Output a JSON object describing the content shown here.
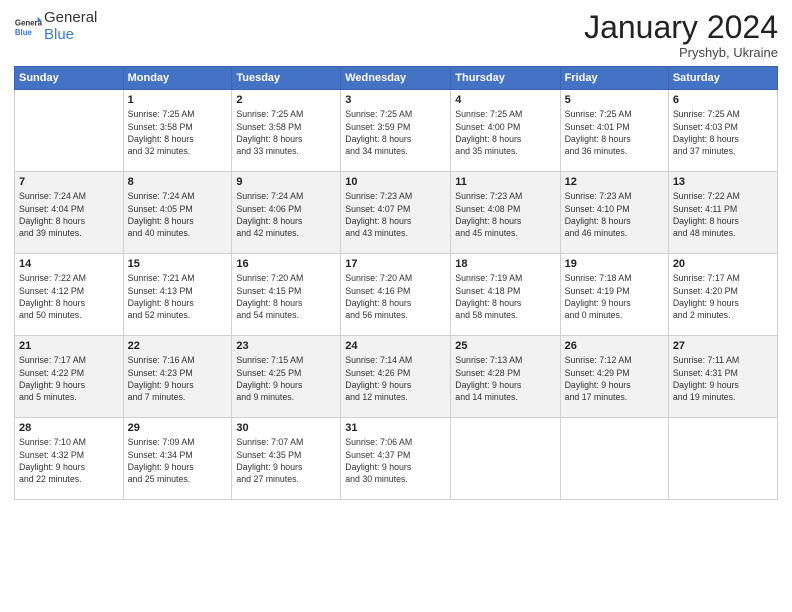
{
  "header": {
    "logo_general": "General",
    "logo_blue": "Blue",
    "month_title": "January 2024",
    "subtitle": "Pryshyb, Ukraine"
  },
  "days_of_week": [
    "Sunday",
    "Monday",
    "Tuesday",
    "Wednesday",
    "Thursday",
    "Friday",
    "Saturday"
  ],
  "weeks": [
    [
      {
        "day": "",
        "detail": ""
      },
      {
        "day": "1",
        "detail": "Sunrise: 7:25 AM\nSunset: 3:58 PM\nDaylight: 8 hours\nand 32 minutes."
      },
      {
        "day": "2",
        "detail": "Sunrise: 7:25 AM\nSunset: 3:58 PM\nDaylight: 8 hours\nand 33 minutes."
      },
      {
        "day": "3",
        "detail": "Sunrise: 7:25 AM\nSunset: 3:59 PM\nDaylight: 8 hours\nand 34 minutes."
      },
      {
        "day": "4",
        "detail": "Sunrise: 7:25 AM\nSunset: 4:00 PM\nDaylight: 8 hours\nand 35 minutes."
      },
      {
        "day": "5",
        "detail": "Sunrise: 7:25 AM\nSunset: 4:01 PM\nDaylight: 8 hours\nand 36 minutes."
      },
      {
        "day": "6",
        "detail": "Sunrise: 7:25 AM\nSunset: 4:03 PM\nDaylight: 8 hours\nand 37 minutes."
      }
    ],
    [
      {
        "day": "7",
        "detail": "Sunrise: 7:24 AM\nSunset: 4:04 PM\nDaylight: 8 hours\nand 39 minutes."
      },
      {
        "day": "8",
        "detail": "Sunrise: 7:24 AM\nSunset: 4:05 PM\nDaylight: 8 hours\nand 40 minutes."
      },
      {
        "day": "9",
        "detail": "Sunrise: 7:24 AM\nSunset: 4:06 PM\nDaylight: 8 hours\nand 42 minutes."
      },
      {
        "day": "10",
        "detail": "Sunrise: 7:23 AM\nSunset: 4:07 PM\nDaylight: 8 hours\nand 43 minutes."
      },
      {
        "day": "11",
        "detail": "Sunrise: 7:23 AM\nSunset: 4:08 PM\nDaylight: 8 hours\nand 45 minutes."
      },
      {
        "day": "12",
        "detail": "Sunrise: 7:23 AM\nSunset: 4:10 PM\nDaylight: 8 hours\nand 46 minutes."
      },
      {
        "day": "13",
        "detail": "Sunrise: 7:22 AM\nSunset: 4:11 PM\nDaylight: 8 hours\nand 48 minutes."
      }
    ],
    [
      {
        "day": "14",
        "detail": "Sunrise: 7:22 AM\nSunset: 4:12 PM\nDaylight: 8 hours\nand 50 minutes."
      },
      {
        "day": "15",
        "detail": "Sunrise: 7:21 AM\nSunset: 4:13 PM\nDaylight: 8 hours\nand 52 minutes."
      },
      {
        "day": "16",
        "detail": "Sunrise: 7:20 AM\nSunset: 4:15 PM\nDaylight: 8 hours\nand 54 minutes."
      },
      {
        "day": "17",
        "detail": "Sunrise: 7:20 AM\nSunset: 4:16 PM\nDaylight: 8 hours\nand 56 minutes."
      },
      {
        "day": "18",
        "detail": "Sunrise: 7:19 AM\nSunset: 4:18 PM\nDaylight: 8 hours\nand 58 minutes."
      },
      {
        "day": "19",
        "detail": "Sunrise: 7:18 AM\nSunset: 4:19 PM\nDaylight: 9 hours\nand 0 minutes."
      },
      {
        "day": "20",
        "detail": "Sunrise: 7:17 AM\nSunset: 4:20 PM\nDaylight: 9 hours\nand 2 minutes."
      }
    ],
    [
      {
        "day": "21",
        "detail": "Sunrise: 7:17 AM\nSunset: 4:22 PM\nDaylight: 9 hours\nand 5 minutes."
      },
      {
        "day": "22",
        "detail": "Sunrise: 7:16 AM\nSunset: 4:23 PM\nDaylight: 9 hours\nand 7 minutes."
      },
      {
        "day": "23",
        "detail": "Sunrise: 7:15 AM\nSunset: 4:25 PM\nDaylight: 9 hours\nand 9 minutes."
      },
      {
        "day": "24",
        "detail": "Sunrise: 7:14 AM\nSunset: 4:26 PM\nDaylight: 9 hours\nand 12 minutes."
      },
      {
        "day": "25",
        "detail": "Sunrise: 7:13 AM\nSunset: 4:28 PM\nDaylight: 9 hours\nand 14 minutes."
      },
      {
        "day": "26",
        "detail": "Sunrise: 7:12 AM\nSunset: 4:29 PM\nDaylight: 9 hours\nand 17 minutes."
      },
      {
        "day": "27",
        "detail": "Sunrise: 7:11 AM\nSunset: 4:31 PM\nDaylight: 9 hours\nand 19 minutes."
      }
    ],
    [
      {
        "day": "28",
        "detail": "Sunrise: 7:10 AM\nSunset: 4:32 PM\nDaylight: 9 hours\nand 22 minutes."
      },
      {
        "day": "29",
        "detail": "Sunrise: 7:09 AM\nSunset: 4:34 PM\nDaylight: 9 hours\nand 25 minutes."
      },
      {
        "day": "30",
        "detail": "Sunrise: 7:07 AM\nSunset: 4:35 PM\nDaylight: 9 hours\nand 27 minutes."
      },
      {
        "day": "31",
        "detail": "Sunrise: 7:06 AM\nSunset: 4:37 PM\nDaylight: 9 hours\nand 30 minutes."
      },
      {
        "day": "",
        "detail": ""
      },
      {
        "day": "",
        "detail": ""
      },
      {
        "day": "",
        "detail": ""
      }
    ]
  ]
}
